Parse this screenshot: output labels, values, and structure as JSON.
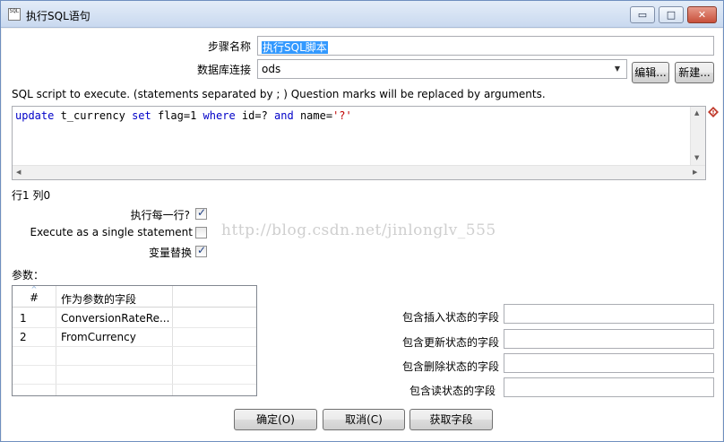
{
  "window": {
    "title": "执行SQL语句",
    "icon_text": "SQL",
    "minimize_glyph": "▭",
    "maximize_glyph": "□",
    "close_glyph": "✕"
  },
  "form": {
    "step_name_label": "步骤名称",
    "step_name_value": "执行SQL脚本",
    "db_conn_label": "数据库连接",
    "db_conn_value": "ods",
    "edit_button": "编辑...",
    "new_button": "新建...",
    "sql_hint": "SQL script to execute. (statements separated by ; ) Question marks will be replaced by arguments."
  },
  "sql": {
    "t1": "update",
    "t2": " t_currency ",
    "t3": "set",
    "t4": " flag=1 ",
    "t5": "where",
    "t6": " id=? ",
    "t7": "and",
    "t8": " name=",
    "t9": "'?'"
  },
  "cursor_pos": "行1 列0",
  "options": {
    "execute_each_row_label": "执行每一行?",
    "execute_each_row_checked": true,
    "single_statement_label": "Execute as a single statement",
    "single_statement_checked": false,
    "variable_substitution_label": "变量替换",
    "variable_substitution_checked": true,
    "checkmark": "✓"
  },
  "watermark": "http://blog.csdn.net/jinlonglv_555",
  "params": {
    "label": "参数：",
    "columns": [
      "#",
      "作为参数的字段"
    ],
    "sort_glyph": "^",
    "rows": [
      {
        "num": "1",
        "field": "ConversionRateRe..."
      },
      {
        "num": "2",
        "field": "FromCurrency"
      }
    ]
  },
  "status_fields": {
    "insert_label": "包含插入状态的字段",
    "update_label": "包含更新状态的字段",
    "delete_label": "包含删除状态的字段",
    "read_label": "包含读状态的字段"
  },
  "buttons": {
    "ok": "确定(O)",
    "cancel": "取消(C)",
    "get_fields": "获取字段"
  }
}
